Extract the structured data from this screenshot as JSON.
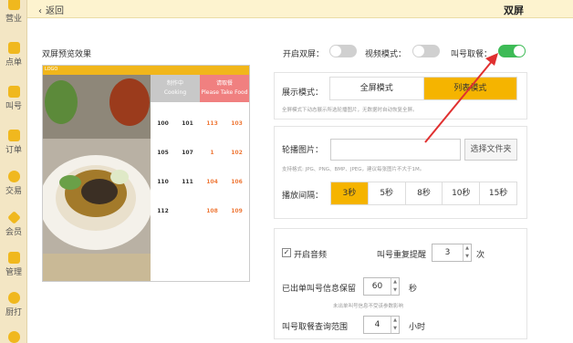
{
  "sidebar": {
    "items": [
      {
        "label": "营业",
        "icon": "store-icon"
      },
      {
        "label": "点单",
        "icon": "hand-icon"
      },
      {
        "label": "叫号",
        "icon": "call-number-icon"
      },
      {
        "label": "订单",
        "icon": "order-icon"
      },
      {
        "label": "交易",
        "icon": "transaction-icon"
      },
      {
        "label": "会员",
        "icon": "member-icon"
      },
      {
        "label": "管理",
        "icon": "manage-icon"
      },
      {
        "label": "厨打",
        "icon": "kitchen-print-icon"
      }
    ]
  },
  "header": {
    "back_label": "返回",
    "title": "双屏"
  },
  "preview": {
    "title": "双屏预览效果",
    "bar_text": "LOGO",
    "left_header_cn": "制作中",
    "left_header_en": "Cooking",
    "right_header_cn": "请取餐",
    "right_header_en": "Please Take Food",
    "cooking_numbers": [
      "100",
      "101",
      "105",
      "107",
      "110",
      "111",
      "112"
    ],
    "ready_numbers": [
      "113",
      "103",
      "1",
      "102",
      "104",
      "106",
      "108",
      "109"
    ]
  },
  "settings": {
    "dual_screen_label": "开启双屏：",
    "dual_screen_on": false,
    "video_mode_label": "视频模式：",
    "video_mode_on": false,
    "call_pickup_label": "叫号取餐：",
    "call_pickup_on": true,
    "display_mode_label": "展示模式：",
    "display_modes": [
      "全屏模式",
      "列表模式"
    ],
    "display_mode_active": "列表模式",
    "display_hint": "全屏模式下动态展示所选轮播图片，无数据时自动恢复全屏。",
    "carousel_label": "轮播图片：",
    "carousel_value": "",
    "choose_file_label": "选择文件夹",
    "carousel_hint": "支持格式: JPG、PNG、BMP、JPEG，建议每张图片不大于1M。",
    "interval_label": "播放间隔：",
    "intervals": [
      "3秒",
      "5秒",
      "8秒",
      "10秒",
      "15秒"
    ],
    "interval_active": "3秒",
    "sound_label": "开启音频",
    "sound_checked": true,
    "repeat_label": "叫号重复提醒",
    "repeat_value": "3",
    "repeat_unit": "次",
    "retain_label": "已出单叫号信息保留",
    "retain_value": "60",
    "retain_unit": "秒",
    "retain_hint": "未出单叫号信息不受该参数影响",
    "range_label": "叫号取餐查询范围",
    "range_value": "4",
    "range_unit": "小时"
  },
  "colors": {
    "accent": "#f5b400",
    "toggle_on": "#3dbb56",
    "arrow": "#e03030",
    "sidebar_bg": "#f3e6c4"
  }
}
